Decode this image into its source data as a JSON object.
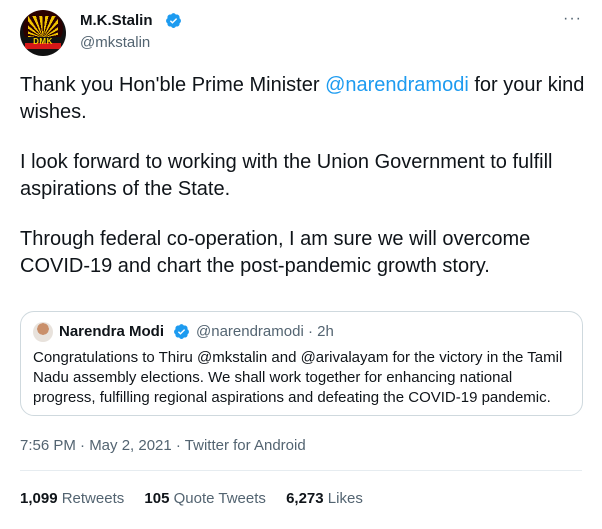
{
  "author": {
    "display_name": "M.K.Stalin",
    "handle": "@mkstalin",
    "avatar_text": "DMK",
    "verified_color": "#1d9bf0"
  },
  "menu": {
    "more_label": "···"
  },
  "tweet": {
    "p1_prefix": "Thank you Hon'ble Prime Minister ",
    "p1_mention": "@narendramodi",
    "p1_suffix": " for your kind wishes.",
    "p2": "I look forward to working with the Union Government to fulfill aspirations of the State.",
    "p3": "Through federal co-operation, I am sure we will overcome COVID-19 and chart the post-pandemic growth story."
  },
  "quote": {
    "display_name": "Narendra Modi",
    "handle_time": "@narendramodi · 2h",
    "text": "Congratulations to Thiru @mkstalin and @arivalayam for the victory in the Tamil Nadu assembly elections. We shall work together for enhancing national progress, fulfilling regional aspirations and defeating the COVID-19 pandemic."
  },
  "meta": {
    "timestamp": "7:56 PM · May 2, 2021 · Twitter for Android"
  },
  "stats": {
    "retweets_count": "1,099",
    "retweets_label": "Retweets",
    "quotes_count": "105",
    "quotes_label": "Quote Tweets",
    "likes_count": "6,273",
    "likes_label": "Likes"
  },
  "colors": {
    "accent": "#1d9bf0",
    "text": "#0f1419",
    "muted": "#536471",
    "border": "#cfd9de"
  }
}
